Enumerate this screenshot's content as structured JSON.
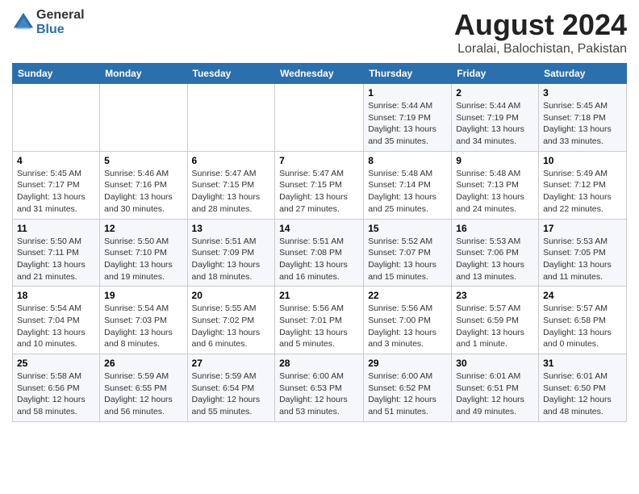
{
  "logo": {
    "general": "General",
    "blue": "Blue"
  },
  "title": "August 2024",
  "subtitle": "Loralai, Balochistan, Pakistan",
  "days_of_week": [
    "Sunday",
    "Monday",
    "Tuesday",
    "Wednesday",
    "Thursday",
    "Friday",
    "Saturday"
  ],
  "weeks": [
    [
      {
        "day": "",
        "sunrise": "",
        "sunset": "",
        "daylight": ""
      },
      {
        "day": "",
        "sunrise": "",
        "sunset": "",
        "daylight": ""
      },
      {
        "day": "",
        "sunrise": "",
        "sunset": "",
        "daylight": ""
      },
      {
        "day": "",
        "sunrise": "",
        "sunset": "",
        "daylight": ""
      },
      {
        "day": "1",
        "sunrise": "Sunrise: 5:44 AM",
        "sunset": "Sunset: 7:19 PM",
        "daylight": "Daylight: 13 hours and 35 minutes."
      },
      {
        "day": "2",
        "sunrise": "Sunrise: 5:44 AM",
        "sunset": "Sunset: 7:19 PM",
        "daylight": "Daylight: 13 hours and 34 minutes."
      },
      {
        "day": "3",
        "sunrise": "Sunrise: 5:45 AM",
        "sunset": "Sunset: 7:18 PM",
        "daylight": "Daylight: 13 hours and 33 minutes."
      }
    ],
    [
      {
        "day": "4",
        "sunrise": "Sunrise: 5:45 AM",
        "sunset": "Sunset: 7:17 PM",
        "daylight": "Daylight: 13 hours and 31 minutes."
      },
      {
        "day": "5",
        "sunrise": "Sunrise: 5:46 AM",
        "sunset": "Sunset: 7:16 PM",
        "daylight": "Daylight: 13 hours and 30 minutes."
      },
      {
        "day": "6",
        "sunrise": "Sunrise: 5:47 AM",
        "sunset": "Sunset: 7:15 PM",
        "daylight": "Daylight: 13 hours and 28 minutes."
      },
      {
        "day": "7",
        "sunrise": "Sunrise: 5:47 AM",
        "sunset": "Sunset: 7:15 PM",
        "daylight": "Daylight: 13 hours and 27 minutes."
      },
      {
        "day": "8",
        "sunrise": "Sunrise: 5:48 AM",
        "sunset": "Sunset: 7:14 PM",
        "daylight": "Daylight: 13 hours and 25 minutes."
      },
      {
        "day": "9",
        "sunrise": "Sunrise: 5:48 AM",
        "sunset": "Sunset: 7:13 PM",
        "daylight": "Daylight: 13 hours and 24 minutes."
      },
      {
        "day": "10",
        "sunrise": "Sunrise: 5:49 AM",
        "sunset": "Sunset: 7:12 PM",
        "daylight": "Daylight: 13 hours and 22 minutes."
      }
    ],
    [
      {
        "day": "11",
        "sunrise": "Sunrise: 5:50 AM",
        "sunset": "Sunset: 7:11 PM",
        "daylight": "Daylight: 13 hours and 21 minutes."
      },
      {
        "day": "12",
        "sunrise": "Sunrise: 5:50 AM",
        "sunset": "Sunset: 7:10 PM",
        "daylight": "Daylight: 13 hours and 19 minutes."
      },
      {
        "day": "13",
        "sunrise": "Sunrise: 5:51 AM",
        "sunset": "Sunset: 7:09 PM",
        "daylight": "Daylight: 13 hours and 18 minutes."
      },
      {
        "day": "14",
        "sunrise": "Sunrise: 5:51 AM",
        "sunset": "Sunset: 7:08 PM",
        "daylight": "Daylight: 13 hours and 16 minutes."
      },
      {
        "day": "15",
        "sunrise": "Sunrise: 5:52 AM",
        "sunset": "Sunset: 7:07 PM",
        "daylight": "Daylight: 13 hours and 15 minutes."
      },
      {
        "day": "16",
        "sunrise": "Sunrise: 5:53 AM",
        "sunset": "Sunset: 7:06 PM",
        "daylight": "Daylight: 13 hours and 13 minutes."
      },
      {
        "day": "17",
        "sunrise": "Sunrise: 5:53 AM",
        "sunset": "Sunset: 7:05 PM",
        "daylight": "Daylight: 13 hours and 11 minutes."
      }
    ],
    [
      {
        "day": "18",
        "sunrise": "Sunrise: 5:54 AM",
        "sunset": "Sunset: 7:04 PM",
        "daylight": "Daylight: 13 hours and 10 minutes."
      },
      {
        "day": "19",
        "sunrise": "Sunrise: 5:54 AM",
        "sunset": "Sunset: 7:03 PM",
        "daylight": "Daylight: 13 hours and 8 minutes."
      },
      {
        "day": "20",
        "sunrise": "Sunrise: 5:55 AM",
        "sunset": "Sunset: 7:02 PM",
        "daylight": "Daylight: 13 hours and 6 minutes."
      },
      {
        "day": "21",
        "sunrise": "Sunrise: 5:56 AM",
        "sunset": "Sunset: 7:01 PM",
        "daylight": "Daylight: 13 hours and 5 minutes."
      },
      {
        "day": "22",
        "sunrise": "Sunrise: 5:56 AM",
        "sunset": "Sunset: 7:00 PM",
        "daylight": "Daylight: 13 hours and 3 minutes."
      },
      {
        "day": "23",
        "sunrise": "Sunrise: 5:57 AM",
        "sunset": "Sunset: 6:59 PM",
        "daylight": "Daylight: 13 hours and 1 minute."
      },
      {
        "day": "24",
        "sunrise": "Sunrise: 5:57 AM",
        "sunset": "Sunset: 6:58 PM",
        "daylight": "Daylight: 13 hours and 0 minutes."
      }
    ],
    [
      {
        "day": "25",
        "sunrise": "Sunrise: 5:58 AM",
        "sunset": "Sunset: 6:56 PM",
        "daylight": "Daylight: 12 hours and 58 minutes."
      },
      {
        "day": "26",
        "sunrise": "Sunrise: 5:59 AM",
        "sunset": "Sunset: 6:55 PM",
        "daylight": "Daylight: 12 hours and 56 minutes."
      },
      {
        "day": "27",
        "sunrise": "Sunrise: 5:59 AM",
        "sunset": "Sunset: 6:54 PM",
        "daylight": "Daylight: 12 hours and 55 minutes."
      },
      {
        "day": "28",
        "sunrise": "Sunrise: 6:00 AM",
        "sunset": "Sunset: 6:53 PM",
        "daylight": "Daylight: 12 hours and 53 minutes."
      },
      {
        "day": "29",
        "sunrise": "Sunrise: 6:00 AM",
        "sunset": "Sunset: 6:52 PM",
        "daylight": "Daylight: 12 hours and 51 minutes."
      },
      {
        "day": "30",
        "sunrise": "Sunrise: 6:01 AM",
        "sunset": "Sunset: 6:51 PM",
        "daylight": "Daylight: 12 hours and 49 minutes."
      },
      {
        "day": "31",
        "sunrise": "Sunrise: 6:01 AM",
        "sunset": "Sunset: 6:50 PM",
        "daylight": "Daylight: 12 hours and 48 minutes."
      }
    ]
  ]
}
